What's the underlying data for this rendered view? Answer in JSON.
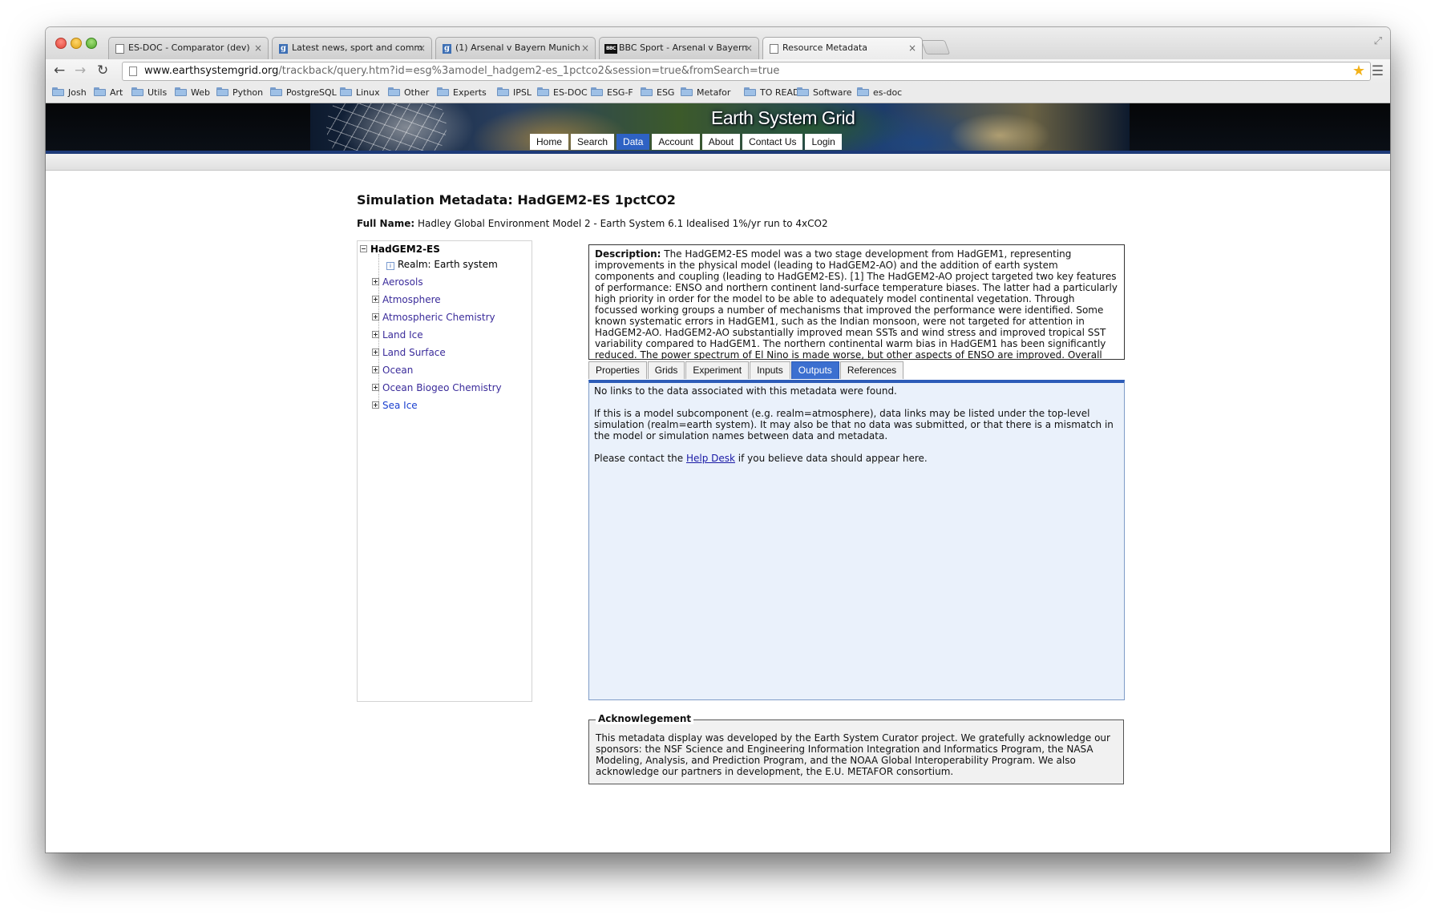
{
  "browser": {
    "tabs": [
      {
        "title": "ES-DOC - Comparator (dev)",
        "icon": "document-icon",
        "active": false
      },
      {
        "title": "Latest news, sport and comm",
        "icon": "guardian-g-icon",
        "active": false
      },
      {
        "title": "(1) Arsenal v Bayern Munich",
        "icon": "guardian-g-icon",
        "active": false
      },
      {
        "title": "BBC Sport - Arsenal v Bayern",
        "icon": "bbc-icon",
        "active": false
      },
      {
        "title": "Resource Metadata",
        "icon": "document-icon",
        "active": true
      }
    ],
    "url_host": "www.earthsystemgrid.org",
    "url_path": "/trackback/query.htm?id=esg%3amodel_hadgem2-es_1pctco2&session=true&fromSearch=true",
    "bookmarks": [
      "Josh",
      "Art",
      "Utils",
      "Web",
      "Python",
      "PostgreSQL",
      "Linux",
      "Other",
      "Experts",
      "IPSL",
      "ES-DOC",
      "ESG-F",
      "ESG",
      "Metafor",
      "TO READ",
      "Software",
      "es-doc"
    ],
    "accent_star": "#f3b21a"
  },
  "site": {
    "title": "Earth System Grid",
    "nav": [
      {
        "label": "Home",
        "active": false
      },
      {
        "label": "Search",
        "active": false
      },
      {
        "label": "Data",
        "active": true
      },
      {
        "label": "Account",
        "active": false
      },
      {
        "label": "About",
        "active": false
      },
      {
        "label": "Contact Us",
        "active": false
      },
      {
        "label": "Login",
        "active": false
      }
    ],
    "nav_active_color": "#2e62c4"
  },
  "page": {
    "heading": "Simulation Metadata: HadGEM2-ES 1pctCO2",
    "full_name_label": "Full Name:",
    "full_name_value": "Hadley Global Environment Model 2 - Earth System 6.1 Idealised 1%/yr run to 4xCO2",
    "tree": {
      "root": "HadGEM2-ES",
      "realm": "Realm: Earth system",
      "children": [
        "Aerosols",
        "Atmosphere",
        "Atmospheric Chemistry",
        "Land Ice",
        "Land Surface",
        "Ocean",
        "Ocean Biogeo Chemistry",
        "Sea Ice"
      ]
    },
    "description_label": "Description:",
    "description_text": "The HadGEM2-ES model was a two stage development from HadGEM1, representing improvements in the physical model (leading to HadGEM2-AO) and the addition of earth system components and coupling (leading to HadGEM2-ES). [1] The HadGEM2-AO project targeted two key features of performance: ENSO and northern continent land-surface temperature biases. The latter had a particularly high priority in order for the model to be able to adequately model continental vegetation. Through focussed working groups a number of mechanisms that improved the performance were identified. Some known systematic errors in HadGEM1, such as the Indian monsoon, were not targeted for attention in HadGEM2-AO. HadGEM2-AO substantially improved mean SSTs and wind stress and improved tropical SST variability compared to HadGEM1. The northern continental warm bias in HadGEM1 has been significantly reduced. The power spectrum of El Nino is made worse, but other aspects of ENSO are improved. Overall there is a",
    "tabs": [
      {
        "label": "Properties",
        "active": false
      },
      {
        "label": "Grids",
        "active": false
      },
      {
        "label": "Experiment",
        "active": false
      },
      {
        "label": "Inputs",
        "active": false
      },
      {
        "label": "Outputs",
        "active": true
      },
      {
        "label": "References",
        "active": false
      }
    ],
    "outputs": {
      "line1": "No links to the data associated with this metadata were found.",
      "line2": "If this is a model subcomponent (e.g. realm=atmosphere), data links may be listed under the top-level simulation (realm=earth system). It may also be that no data was submitted, or that there is a mismatch in the model or simulation names between data and metadata.",
      "line3_before": "Please contact the ",
      "help_desk_link": "Help Desk",
      "line3_after": " if you believe data should appear here."
    },
    "acknowledgement": {
      "legend": "Acknowlegement",
      "text": "This metadata display was developed by the Earth System Curator project. We gratefully acknowledge our sponsors: the NSF Science and Engineering Information Integration and Informatics Program, the NASA Modeling, Analysis, and Prediction Program, and the NOAA Global Interoperability Program. We also acknowledge our partners in development, the E.U. METAFOR consortium."
    }
  }
}
